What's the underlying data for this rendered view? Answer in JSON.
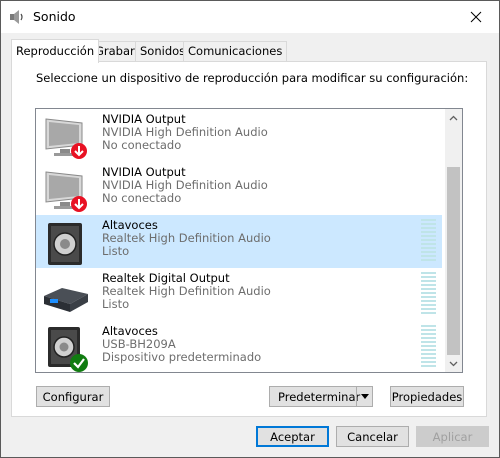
{
  "window": {
    "title": "Sonido"
  },
  "tabs": [
    {
      "label": "Reproducción",
      "active": true
    },
    {
      "label": "Grabar"
    },
    {
      "label": "Sonidos"
    },
    {
      "label": "Comunicaciones"
    }
  ],
  "instruction": "Seleccione un dispositivo de reproducción para modificar su configuración:",
  "devices": [
    {
      "name": "NVIDIA Output",
      "driver": "NVIDIA High Definition Audio",
      "status": "No conectado",
      "icon": "monitor-icon",
      "badge": "disconnected-arrow-icon"
    },
    {
      "name": "NVIDIA Output",
      "driver": "NVIDIA High Definition Audio",
      "status": "No conectado",
      "icon": "monitor-icon",
      "badge": "disconnected-arrow-icon"
    },
    {
      "name": "Altavoces",
      "driver": "Realtek High Definition Audio",
      "status": "Listo",
      "icon": "speaker-icon",
      "selected": true
    },
    {
      "name": "Realtek Digital Output",
      "driver": "Realtek High Definition Audio",
      "status": "Listo",
      "icon": "digital-output-icon"
    },
    {
      "name": "Altavoces",
      "driver": "USB-BH209A",
      "status": "Dispositivo predeterminado",
      "icon": "speaker-icon",
      "badge": "default-check-icon"
    }
  ],
  "buttons": {
    "configure": "Configurar",
    "set_default": "Predeterminar",
    "properties": "Propiedades",
    "ok": "Aceptar",
    "cancel": "Cancelar",
    "apply": "Aplicar"
  },
  "colors": {
    "selection": "#cce8ff",
    "accent": "#0078d7",
    "badge_red": "#e81123",
    "badge_green": "#107c10"
  }
}
